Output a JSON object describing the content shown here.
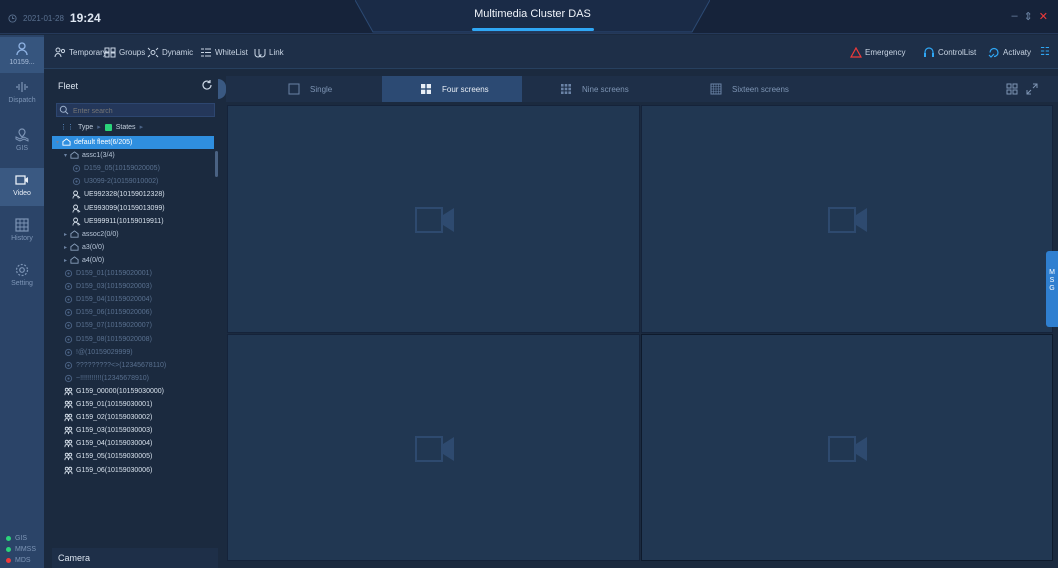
{
  "window": {
    "date": "2021-01-28",
    "time": "19:24",
    "title": "Multimedia Cluster DAS"
  },
  "rail": {
    "user_id": "10159...",
    "items": [
      {
        "label": "Dispatch",
        "icon": "dispatch-icon"
      },
      {
        "label": "GIS",
        "icon": "gis-icon"
      },
      {
        "label": "Video",
        "icon": "video-icon",
        "active": true
      },
      {
        "label": "History",
        "icon": "history-icon"
      },
      {
        "label": "Setting",
        "icon": "setting-icon"
      }
    ],
    "status": [
      {
        "label": "GIS",
        "color": "#2bd47a"
      },
      {
        "label": "MMSS",
        "color": "#2bd47a"
      },
      {
        "label": "MDS",
        "color": "#f03a3a"
      }
    ]
  },
  "toolbar": {
    "left": [
      "Temporary",
      "Groups",
      "Dynamic",
      "WhiteList",
      "Link"
    ],
    "right": [
      "Emergency",
      "ControlList",
      "Activaty"
    ]
  },
  "fleet": {
    "title": "Fleet",
    "search_placeholder": "Enter search",
    "filter_type": "Type",
    "filter_states": "States",
    "camera_label": "Camera",
    "tree": [
      {
        "label": "default fleet(6/205)",
        "kind": "sel",
        "indent": 0
      },
      {
        "label": "assc1(3/4)",
        "kind": "grp",
        "indent": 1
      },
      {
        "label": "D159_05(10159020005)",
        "kind": "off",
        "indent": 2
      },
      {
        "label": "U3099-2(10159010002)",
        "kind": "off",
        "indent": 2
      },
      {
        "label": "UE992328(10159012328)",
        "kind": "on",
        "indent": 2
      },
      {
        "label": "UE993099(10159013099)",
        "kind": "on",
        "indent": 2
      },
      {
        "label": "UE999911(10159019911)",
        "kind": "on",
        "indent": 2
      },
      {
        "label": "assoc2(0/0)",
        "kind": "grp",
        "indent": 1
      },
      {
        "label": "a3(0/0)",
        "kind": "grp",
        "indent": 1
      },
      {
        "label": "a4(0/0)",
        "kind": "grp",
        "indent": 1
      },
      {
        "label": "D159_01(10159020001)",
        "kind": "off",
        "indent": 1
      },
      {
        "label": "D159_03(10159020003)",
        "kind": "off",
        "indent": 1
      },
      {
        "label": "D159_04(10159020004)",
        "kind": "off",
        "indent": 1
      },
      {
        "label": "D159_06(10159020006)",
        "kind": "off",
        "indent": 1
      },
      {
        "label": "D159_07(10159020007)",
        "kind": "off",
        "indent": 1
      },
      {
        "label": "D159_08(10159020008)",
        "kind": "off",
        "indent": 1
      },
      {
        "label": "!@(10159029999)",
        "kind": "off",
        "indent": 1
      },
      {
        "label": "?????????<>(12345678110)",
        "kind": "off",
        "indent": 1
      },
      {
        "label": "~!!!!!!!!!!!(12345678910)",
        "kind": "off",
        "indent": 1
      },
      {
        "label": "G159_00000(10159030000)",
        "kind": "gw",
        "indent": 1
      },
      {
        "label": "G159_01(10159030001)",
        "kind": "gw",
        "indent": 1
      },
      {
        "label": "G159_02(10159030002)",
        "kind": "gw",
        "indent": 1
      },
      {
        "label": "G159_03(10159030003)",
        "kind": "gw",
        "indent": 1
      },
      {
        "label": "G159_04(10159030004)",
        "kind": "gw",
        "indent": 1
      },
      {
        "label": "G159_05(10159030005)",
        "kind": "gw",
        "indent": 1
      },
      {
        "label": "G159_06(10159030006)",
        "kind": "gw",
        "indent": 1
      }
    ]
  },
  "video": {
    "tabs": [
      "Single",
      "Four screens",
      "Nine screens",
      "Sixteen screens"
    ],
    "active_tab": "Four screens",
    "panes": 4
  },
  "msg_tab": "MSG",
  "colors": {
    "accent": "#2f8fe0",
    "emergency": "#f03a3a",
    "online": "#2bd47a"
  }
}
